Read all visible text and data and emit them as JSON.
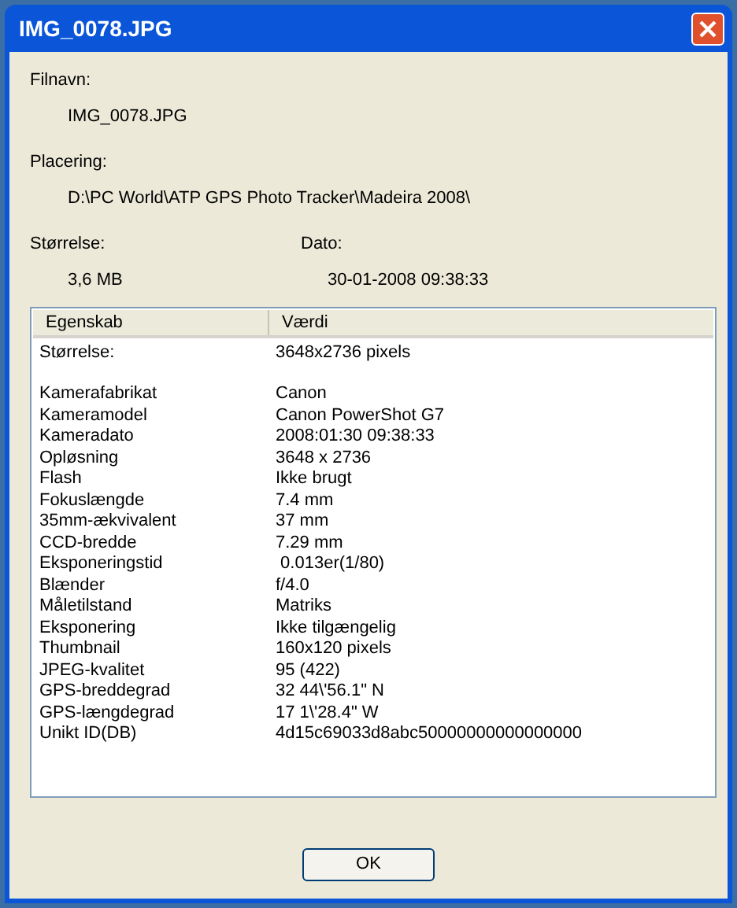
{
  "window": {
    "title": "IMG_0078.JPG"
  },
  "fields": [
    {
      "label": "Filnavn:",
      "value": "IMG_0078.JPG"
    },
    {
      "label": "Placering:",
      "value": "D:\\PC World\\ATP GPS Photo Tracker\\Madeira 2008\\"
    }
  ],
  "size": {
    "label": "Størrelse:",
    "value": "3,6 MB"
  },
  "date": {
    "label": "Dato:",
    "value": "30-01-2008 09:38:33"
  },
  "table": {
    "columns": [
      "Egenskab",
      "Værdi"
    ],
    "groups": [
      [
        [
          "Størrelse:",
          "3648x2736 pixels"
        ]
      ],
      [
        [
          "Kamerafabrikat",
          "Canon"
        ],
        [
          "Kameramodel",
          "Canon PowerShot G7"
        ],
        [
          "Kameradato",
          "2008:01:30 09:38:33"
        ],
        [
          "Opløsning",
          "3648 x 2736"
        ],
        [
          "Flash",
          "Ikke brugt"
        ],
        [
          "Fokuslængde",
          "7.4 mm"
        ],
        [
          "35mm-ækvivalent",
          "37 mm"
        ],
        [
          "CCD-bredde",
          "7.29 mm"
        ],
        [
          "Eksponeringstid",
          " 0.013er(1/80)"
        ],
        [
          "Blænder",
          "f/4.0"
        ],
        [
          "Måletilstand",
          "Matriks"
        ],
        [
          "Eksponering",
          "Ikke tilgængelig"
        ],
        [
          "Thumbnail",
          "160x120 pixels"
        ],
        [
          "JPEG-kvalitet",
          "95 (422)"
        ],
        [
          "GPS-breddegrad",
          "32 44\\'56.1\" N"
        ],
        [
          "GPS-længdegrad",
          "17 1\\'28.4\" W"
        ],
        [
          "Unikt ID(DB)",
          "4d15c69033d8abc50000000000000000"
        ]
      ]
    ]
  },
  "buttons": [
    "OK"
  ]
}
